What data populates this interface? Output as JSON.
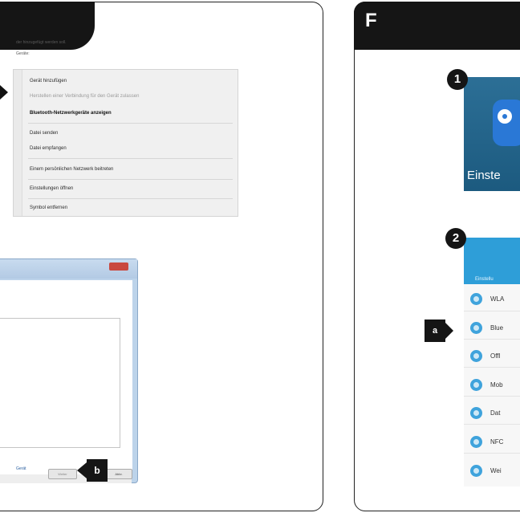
{
  "panel_right": {
    "letter": "F"
  },
  "context_menu": {
    "items": [
      {
        "label": "Gerät hinzufügen",
        "style": "normal"
      },
      {
        "label": "Herstellen einer Verbindung für den Gerät zulassen",
        "style": "disabled"
      },
      {
        "label": "Bluetooth-Netzwerkgeräte anzeigen",
        "style": "bold"
      },
      {
        "label": "Datei senden",
        "style": "normal"
      },
      {
        "label": "Datei empfangen",
        "style": "normal"
      },
      {
        "label": "Einem persönlichen Netzwerk beitreten",
        "style": "normal"
      },
      {
        "label": "Einstellungen öffnen",
        "style": "normal"
      },
      {
        "label": "Symbol entfernen",
        "style": "normal"
      }
    ]
  },
  "dialog": {
    "text1": "der hinzugefügt werden soll.",
    "text2": "Geräte:",
    "link": "Gerät",
    "next_label": "Weiter",
    "cancel_label": "Abbr."
  },
  "callouts": {
    "a": "a",
    "b": "b"
  },
  "steps": {
    "one": "1",
    "two": "2"
  },
  "settings_tile": {
    "label": "Einste",
    "icon": "gear-icon"
  },
  "phone_settings": {
    "header": "Einstellu",
    "items": [
      {
        "label": "WLA",
        "icon": "wifi-icon"
      },
      {
        "label": "Blue",
        "icon": "bluetooth-icon"
      },
      {
        "label": "Offl",
        "icon": "airplane-icon"
      },
      {
        "label": "Mob",
        "icon": "mobile-data-icon"
      },
      {
        "label": "Dat",
        "icon": "data-usage-icon"
      },
      {
        "label": "NFC",
        "icon": "nfc-icon"
      },
      {
        "label": "Wei",
        "icon": "more-icon"
      }
    ]
  },
  "colors": {
    "accent_blue": "#2e9ed8",
    "callout": "#151515",
    "settings_tile": "#1c5a7f"
  }
}
